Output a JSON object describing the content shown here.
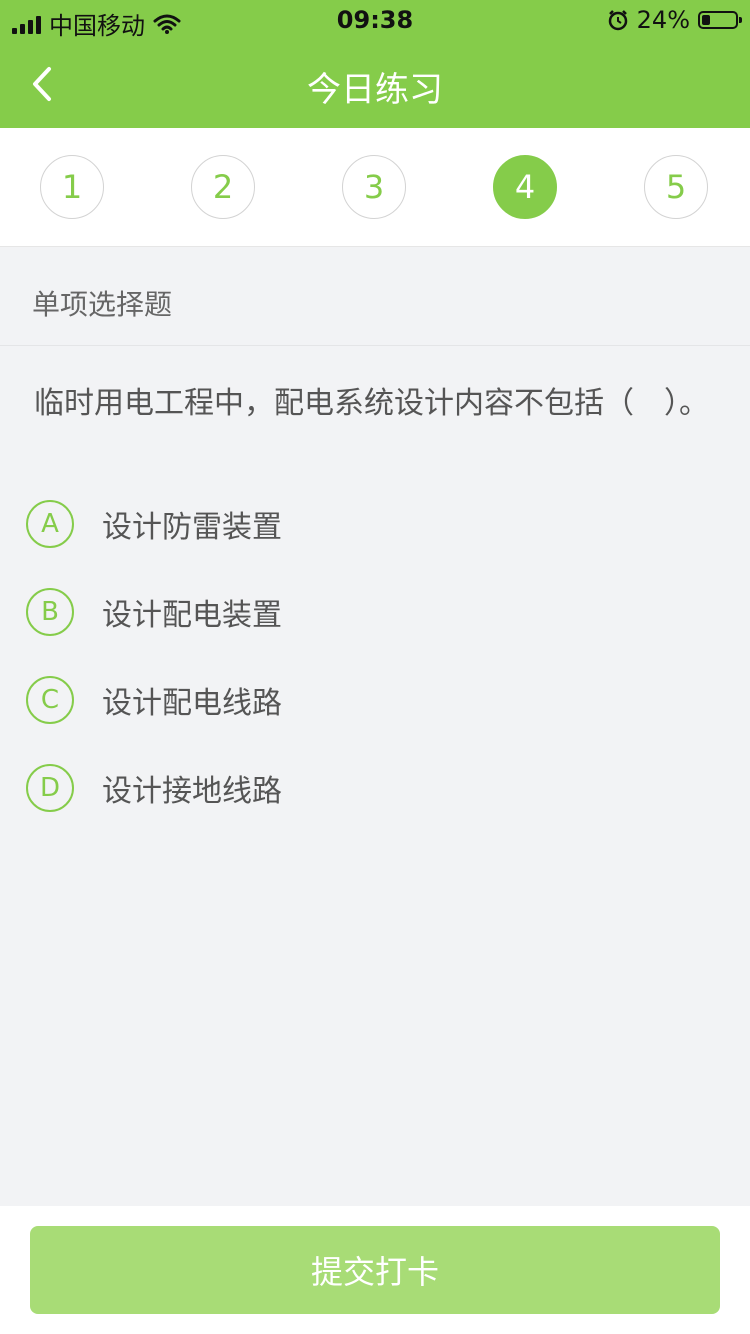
{
  "status_bar": {
    "carrier": "中国移动",
    "time": "09:38",
    "battery_text": "24%",
    "battery_level": 0.24
  },
  "nav": {
    "title": "今日练习"
  },
  "steps": [
    {
      "label": "1",
      "active": false
    },
    {
      "label": "2",
      "active": false
    },
    {
      "label": "3",
      "active": false
    },
    {
      "label": "4",
      "active": true
    },
    {
      "label": "5",
      "active": false
    }
  ],
  "question": {
    "type": "单项选择题",
    "text": "临时用电工程中，配电系统设计内容不包括（　）。",
    "options": [
      {
        "letter": "A",
        "text": "设计防雷装置"
      },
      {
        "letter": "B",
        "text": "设计配电装置"
      },
      {
        "letter": "C",
        "text": "设计配电线路"
      },
      {
        "letter": "D",
        "text": "设计接地线路"
      }
    ]
  },
  "submit": {
    "label": "提交打卡"
  },
  "colors": {
    "brand_green": "#85cc4a",
    "button_green": "#a8dc76",
    "background": "#f2f3f5"
  }
}
